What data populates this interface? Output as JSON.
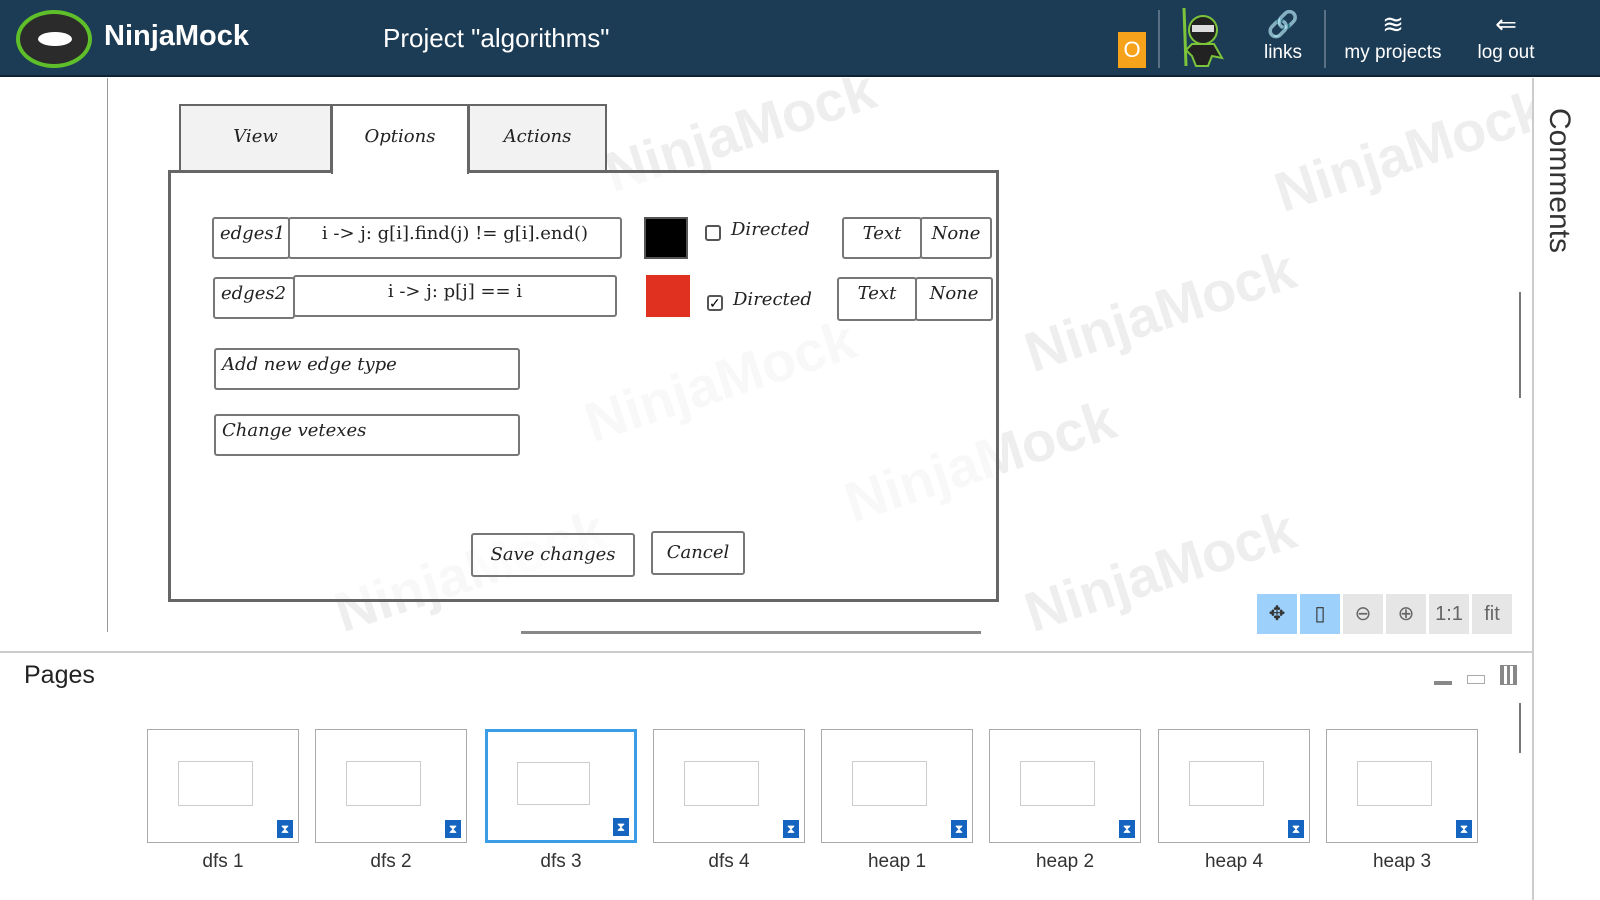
{
  "header": {
    "brand": "NinjaMock",
    "project_title": "Project \"algorithms\"",
    "badge": "O",
    "links": "links",
    "my_projects": "my projects",
    "log_out": "log out"
  },
  "mockup": {
    "tabs": [
      "View",
      "Options",
      "Actions"
    ],
    "edges": [
      {
        "name": "edges1",
        "expr": "i -> j: g[i].find(j) != g[i].end()",
        "color": "#000000",
        "directed_label": "Directed",
        "directed": false,
        "text": "Text",
        "none": "None"
      },
      {
        "name": "edges2",
        "expr": "i -> j: p[j] == i",
        "color": "#e03020",
        "directed_label": "Directed",
        "directed": true,
        "text": "Text",
        "none": "None"
      }
    ],
    "add_edge": "Add new edge type",
    "change_vertexes": "Change vetexes",
    "save": "Save changes",
    "cancel": "Cancel"
  },
  "watermark": "NinjaMock",
  "zoom_controls": {
    "one_to_one": "1:1",
    "fit": "fit"
  },
  "sidebar": {
    "comments": "Comments"
  },
  "pages": {
    "title": "Pages",
    "selected": "dfs 3",
    "items": [
      "dfs 1",
      "dfs 2",
      "dfs 3",
      "dfs 4",
      "heap 1",
      "heap 2",
      "heap 4",
      "heap 3"
    ]
  }
}
